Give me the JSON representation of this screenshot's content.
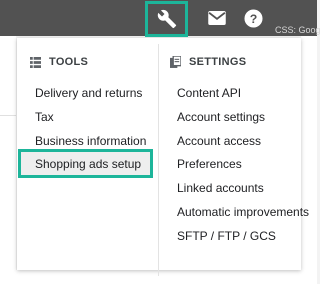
{
  "toolbar": {
    "tools_icon": "wrench-icon",
    "mail_icon": "mail-icon",
    "help_icon": "help-icon",
    "css_label": "CSS: Goog"
  },
  "tools": {
    "heading": "TOOLS",
    "icon": "list-icon",
    "items": [
      "Delivery and returns",
      "Tax",
      "Business information",
      "Shopping ads setup"
    ]
  },
  "settings": {
    "heading": "SETTINGS",
    "icon": "copy-icon",
    "items": [
      "Content API",
      "Account settings",
      "Account access",
      "Preferences",
      "Linked accounts",
      "Automatic improvements",
      "SFTP / FTP / GCS"
    ]
  },
  "colors": {
    "topbar": "#525252",
    "highlight_border": "#1db59a"
  }
}
